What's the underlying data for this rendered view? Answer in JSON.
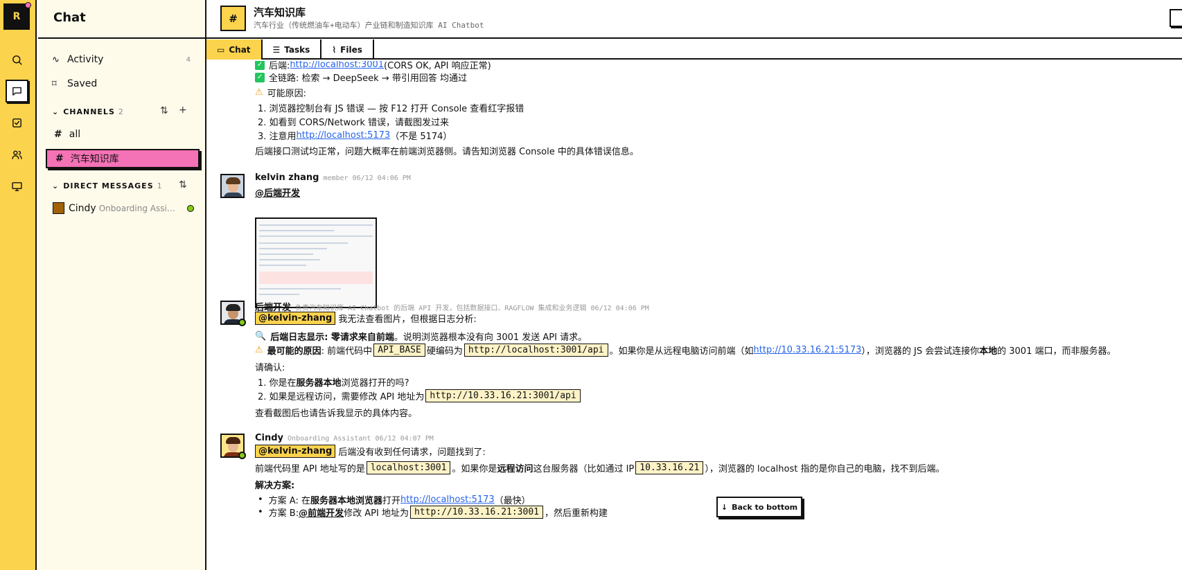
{
  "rail": {
    "logo": "R"
  },
  "sidebar": {
    "title": "Chat",
    "activity": {
      "label": "Activity",
      "count": "4"
    },
    "saved": {
      "label": "Saved"
    },
    "channels": {
      "label": "CHANNELS",
      "count": "2",
      "items": [
        {
          "label": "all"
        },
        {
          "label": "汽车知识库"
        }
      ]
    },
    "dms": {
      "label": "DIRECT MESSAGES",
      "count": "1",
      "items": [
        {
          "name": "Cindy",
          "role": "Onboarding Assist..."
        }
      ]
    }
  },
  "channel": {
    "title": "汽车知识库",
    "subtitle": "汽车行业（传统燃油车+电动车）产业链和制造知识库 AI Chatbot",
    "tabs": [
      {
        "label": "Chat"
      },
      {
        "label": "Tasks"
      },
      {
        "label": "Files"
      }
    ]
  },
  "msg0": {
    "backend_pre": "后端: ",
    "backend_link": "http://localhost:3001",
    "backend_post": " (CORS OK, API 响应正常)",
    "chain": "全链路: 检索 → DeepSeek → 带引用回答 均通过",
    "reasons_title": "可能原因:",
    "r1": "1. 浏览器控制台有 JS 错误 — 按 F12 打开 Console 查看红字报错",
    "r2": "2. 如看到 CORS/Network 错误，请截图发过来",
    "r3_pre": "3. 注意用 ",
    "r3_link": "http://localhost:5173",
    "r3_post": " （不是 5174）",
    "summary": "后端接口测试均正常，问题大概率在前端浏览器侧。请告知浏览器 Console 中的具体错误信息。"
  },
  "msg1": {
    "name": "kelvin zhang",
    "role": "member",
    "time": "06/12 04:06 PM",
    "text": "@后端开发"
  },
  "msg2": {
    "name": "后端开发",
    "role": "负责汽车知识库 AI Chatbot 的后端 API 开发，包括数据接口、RAGFLOW 集成和业务逻辑",
    "time": "06/12 04:06 PM",
    "mention": "@kelvin-zhang",
    "intro": "我无法查看图片，但根据日志分析:",
    "l1_b": "后端日志显示: 零请求来自前端",
    "l1_t": "。说明浏览器根本没有向 3001 发送 API 请求。",
    "l2_b": "最可能的原因",
    "l2_a": ": 前端代码中",
    "l2_code1": "API_BASE",
    "l2_c": "硬编码为",
    "l2_code2": "http://localhost:3001/api",
    "l2_d": "。如果你是从远程电脑访问前端（如 ",
    "l2_link": "http://10.33.16.21:5173",
    "l2_e": "），浏览器的 JS 会尝试连接你",
    "l2_f": "本地",
    "l2_g": "的 3001 端口，而非服务器。",
    "confirm": "请确认:",
    "c1_a": "1. 你是在",
    "c1_b": "服务器本地",
    "c1_c": "浏览器打开的吗?",
    "c2_a": "2. 如果是远程访问，需要修改 API 地址为",
    "c2_code": "http://10.33.16.21:3001/api",
    "end": "查看截图后也请告诉我显示的具体内容。"
  },
  "msg3": {
    "name": "Cindy",
    "role": "Onboarding Assistant",
    "time": "06/12 04:07 PM",
    "mention": "@kelvin-zhang",
    "intro": "后端没有收到任何请求，问题找到了:",
    "l1_a": "前端代码里 API 地址写的是",
    "l1_code": "localhost:3001",
    "l1_b": "。如果你是",
    "l1_c": "远程访问",
    "l1_d": "这台服务器（比如通过 IP",
    "l1_code2": "10.33.16.21",
    "l1_e": "），浏览器的 localhost 指的是你自己的电脑，找不到后端。",
    "solution": "解决方案:",
    "sa_a": "方案 A: 在",
    "sa_b": "服务器本地浏览器",
    "sa_c": "打开 ",
    "sa_link": "http://localhost:5173",
    "sa_d": "（最快）",
    "sb_a": "方案 B: ",
    "sb_b": "@前端开发",
    "sb_c": " 修改 API 地址为",
    "sb_code": "http://10.33.16.21:3001",
    "sb_d": "，然后重新构建"
  },
  "back_to_bottom": "Back to bottom",
  "colors": {
    "accent": "#fcd34d",
    "active_channel": "#f472b6",
    "link": "#2563eb",
    "online": "#84cc16"
  }
}
